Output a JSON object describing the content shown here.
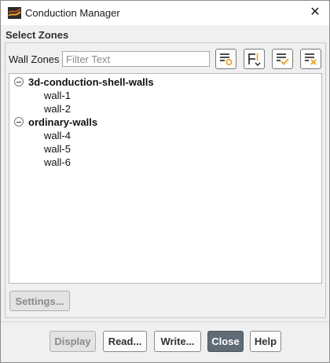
{
  "window": {
    "title": "Conduction Manager",
    "close_glyph": "✕",
    "app_icon": "fluent-app-icon"
  },
  "section": {
    "title": "Select Zones"
  },
  "filter": {
    "label": "Wall Zones",
    "placeholder": "Filter Text",
    "value": ""
  },
  "toolbar": {
    "buttons": [
      {
        "name": "select-all-icon"
      },
      {
        "name": "group-by-type-icon"
      },
      {
        "name": "select-highlighted-icon"
      },
      {
        "name": "deselect-all-icon"
      }
    ]
  },
  "tree": {
    "groups": [
      {
        "label": "3d-conduction-shell-walls",
        "expanded": true,
        "children": [
          "wall-1",
          "wall-2"
        ]
      },
      {
        "label": "ordinary-walls",
        "expanded": true,
        "children": [
          "wall-4",
          "wall-5",
          "wall-6"
        ]
      }
    ]
  },
  "settings": {
    "label": "Settings...",
    "enabled": false
  },
  "buttons": {
    "display": {
      "label": "Display",
      "enabled": false
    },
    "read": {
      "label": "Read...",
      "enabled": true
    },
    "write": {
      "label": "Write...",
      "enabled": true
    },
    "close": {
      "label": "Close",
      "enabled": true
    },
    "help": {
      "label": "Help",
      "enabled": true
    }
  },
  "colors": {
    "primary_button": "#5f6b75",
    "icon_accent": "#f0a020",
    "icon_blue": "#1f5fbf"
  }
}
